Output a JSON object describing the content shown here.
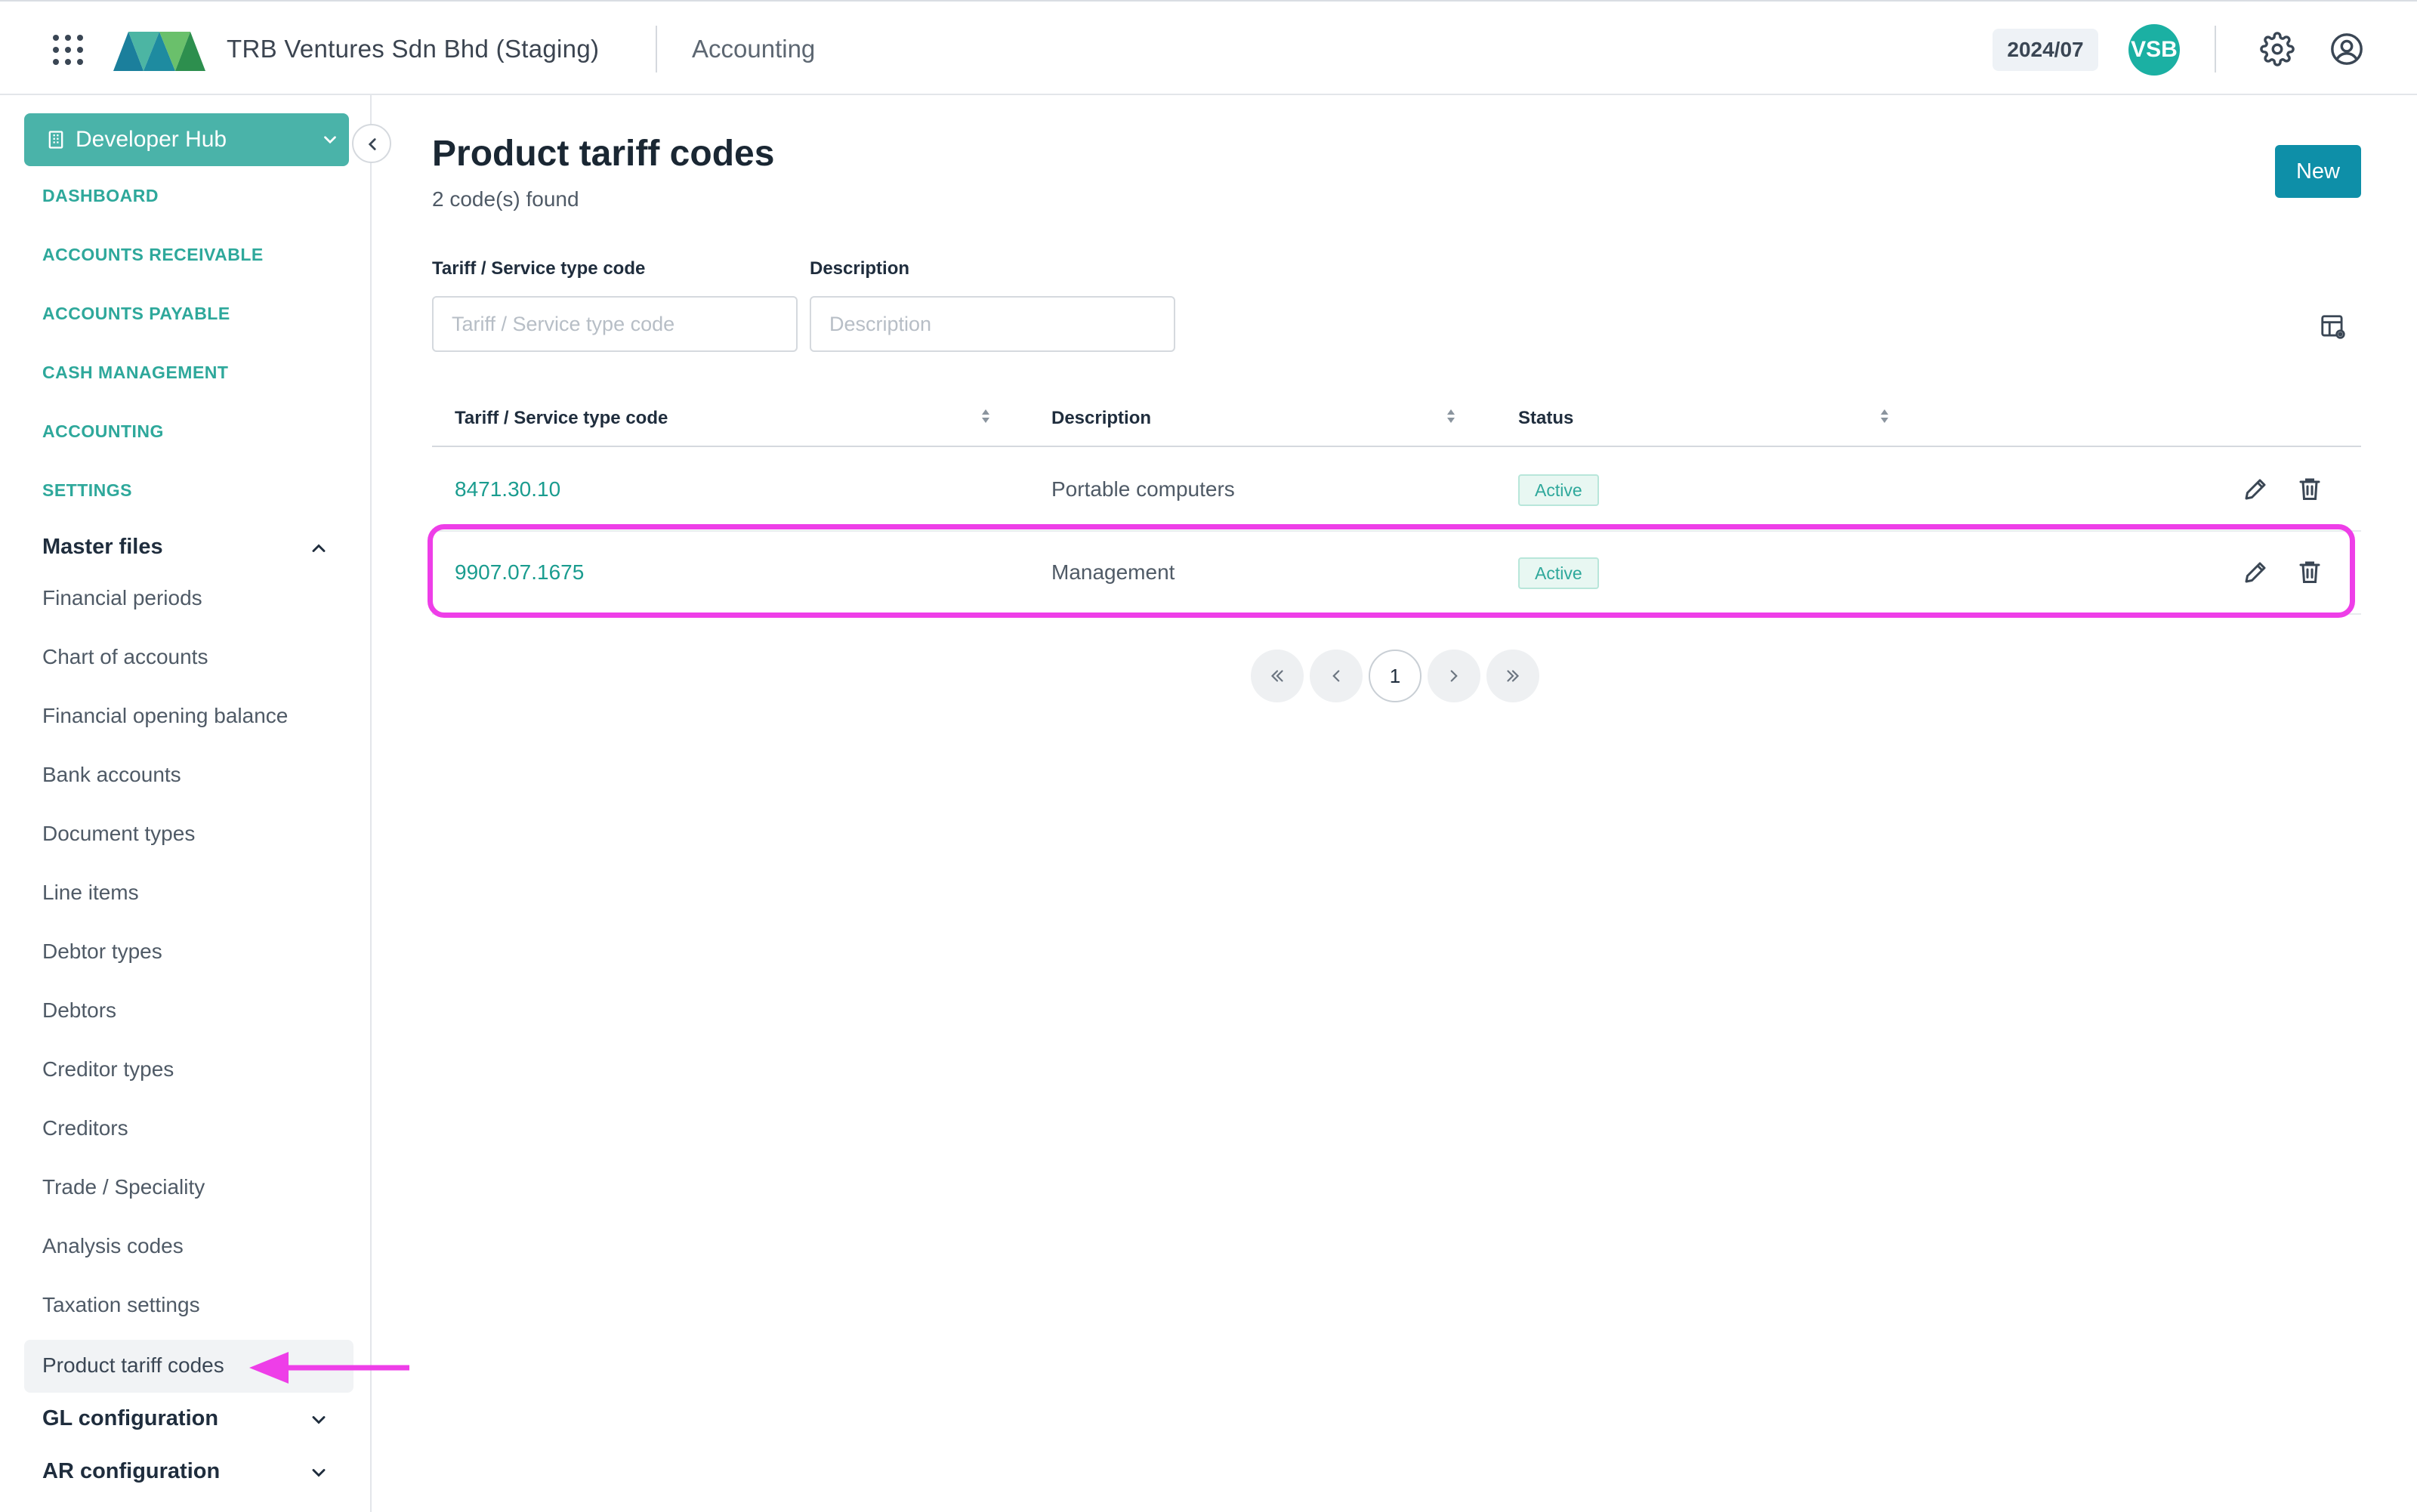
{
  "header": {
    "company": "TRB Ventures Sdn Bhd (Staging)",
    "module": "Accounting",
    "period": "2024/07",
    "avatar_initials": "VSB"
  },
  "sidebar": {
    "hub_label": "Developer Hub",
    "sections": [
      "DASHBOARD",
      "ACCOUNTS RECEIVABLE",
      "ACCOUNTS PAYABLE",
      "CASH MANAGEMENT",
      "ACCOUNTING",
      "SETTINGS"
    ],
    "master_files": {
      "label": "Master files",
      "items": [
        "Financial periods",
        "Chart of accounts",
        "Financial opening balance",
        "Bank accounts",
        "Document types",
        "Line items",
        "Debtor types",
        "Debtors",
        "Creditor types",
        "Creditors",
        "Trade / Speciality",
        "Analysis codes",
        "Taxation settings",
        "Product tariff codes"
      ]
    },
    "gl_config_label": "GL configuration",
    "ar_config_label": "AR configuration"
  },
  "page": {
    "title": "Product tariff codes",
    "count_text": "2 code(s) found",
    "new_button": "New"
  },
  "filters": {
    "code_label": "Tariff / Service type code",
    "code_placeholder": "Tariff / Service type code",
    "desc_label": "Description",
    "desc_placeholder": "Description"
  },
  "table": {
    "columns": [
      "Tariff / Service type code",
      "Description",
      "Status"
    ],
    "rows": [
      {
        "code": "8471.30.10",
        "description": "Portable computers",
        "status": "Active"
      },
      {
        "code": "9907.07.1675",
        "description": "Management",
        "status": "Active"
      }
    ]
  },
  "pagination": {
    "current_page": "1"
  },
  "colors": {
    "accent": "#2ea89b",
    "primary_button": "#0e8fa8",
    "highlight": "#ee3ee8"
  },
  "icons": [
    "apps-grid-icon",
    "settings-gear-icon",
    "user-circle-icon",
    "building-icon",
    "chevron-down-icon",
    "chevron-up-icon",
    "chevron-left-icon",
    "table-settings-icon",
    "sort-icon",
    "edit-pencil-icon",
    "delete-trash-icon",
    "first-page-icon",
    "prev-page-icon",
    "next-page-icon",
    "last-page-icon",
    "pointer-arrow-icon"
  ]
}
